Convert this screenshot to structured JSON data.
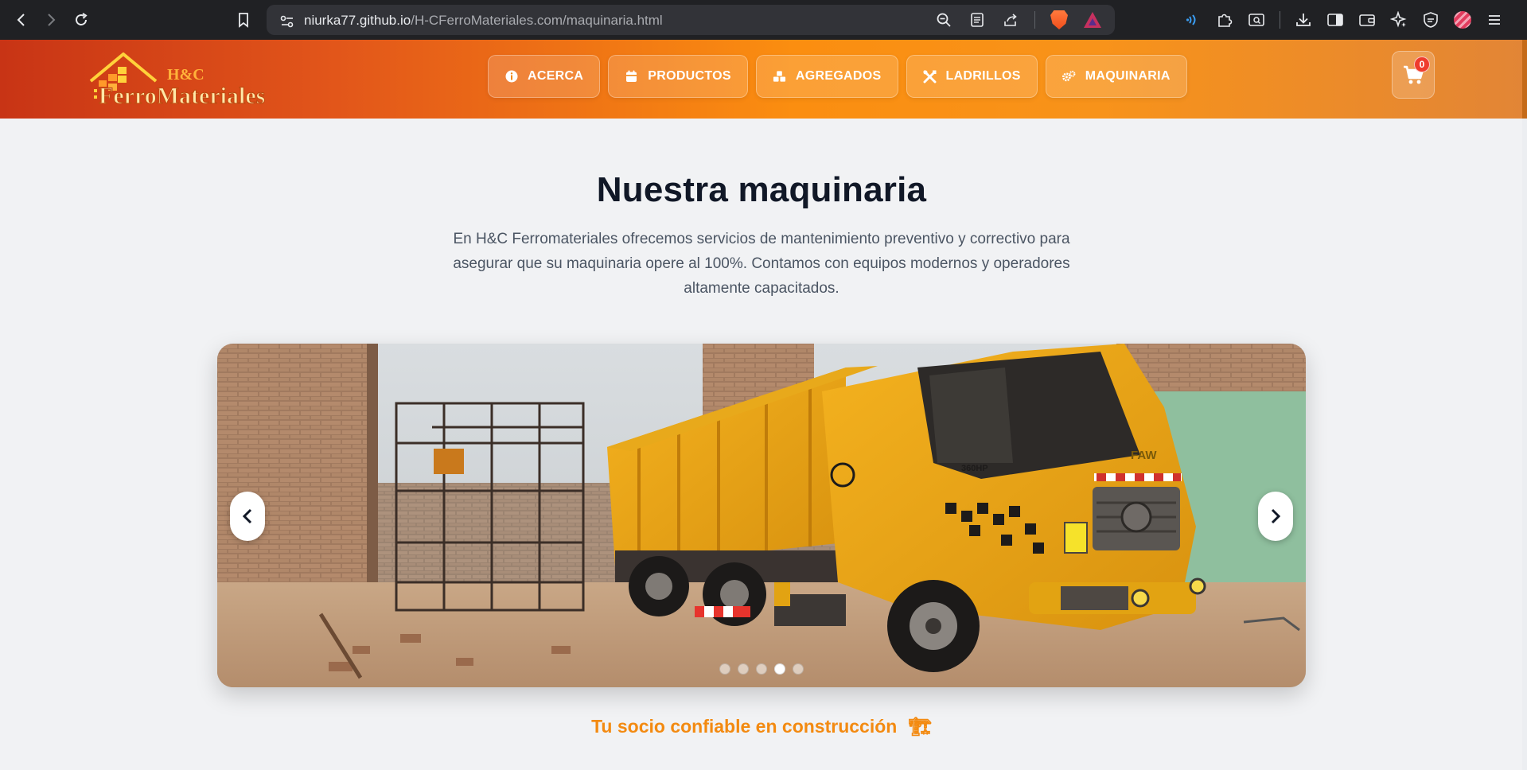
{
  "browser": {
    "url_host": "niurka77.github.io",
    "url_path": "/H-CFerroMateriales.com/maquinaria.html"
  },
  "header": {
    "logo_top_text": "H&C",
    "logo_main_text": "FerroMateriales",
    "nav": [
      {
        "label": "ACERCA",
        "icon": "info-circle-icon"
      },
      {
        "label": "PRODUCTOS",
        "icon": "calendar-icon"
      },
      {
        "label": "AGREGADOS",
        "icon": "cubes-icon"
      },
      {
        "label": "LADRILLOS",
        "icon": "tools-icon"
      },
      {
        "label": "MAQUINARIA",
        "icon": "cogs-icon"
      }
    ],
    "cart_count": "0"
  },
  "main": {
    "title": "Nuestra maquinaria",
    "intro": "En H&C Ferromateriales ofrecemos servicios de mantenimiento preventivo y correctivo para asegurar que su maquinaria opere al 100%. Contamos con equipos modernos y operadores altamente capacitados.",
    "carousel": {
      "slide_count": 5,
      "active_index": 3,
      "image_subject": "FAW dump truck",
      "truck_brand": "FAW",
      "truck_model_plate": "360HP"
    },
    "tagline": "Tu socio confiable en construcción",
    "tagline_emoji": "🏗"
  },
  "colors": {
    "accent": "#f38a11",
    "header_start": "#c83415",
    "header_mid": "#fb8e10",
    "title": "#111827",
    "text": "#4b5563"
  }
}
